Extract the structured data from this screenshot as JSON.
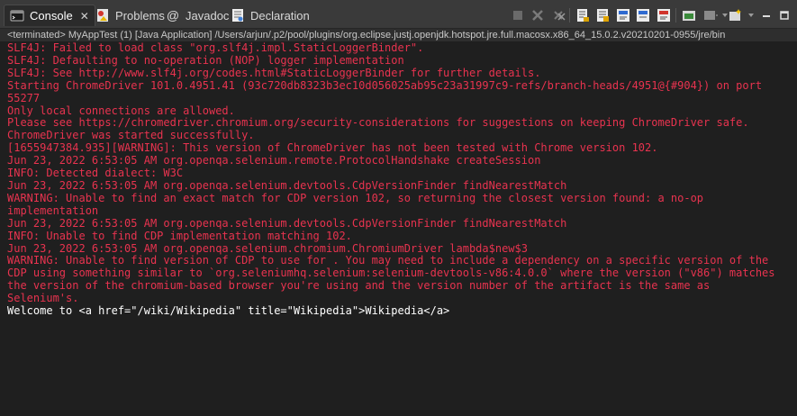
{
  "tabs": [
    {
      "label": "Console",
      "active": true
    },
    {
      "label": "Problems"
    },
    {
      "label": "Javadoc"
    },
    {
      "label": "Declaration"
    }
  ],
  "status_line": "<terminated> MyAppTest (1) [Java Application] /Users/arjun/.p2/pool/plugins/org.eclipse.justj.openjdk.hotspot.jre.full.macosx.x86_64_15.0.2.v20210201-0955/jre/bin",
  "colors": {
    "error_text": "#e8334f",
    "normal_text": "#ffffff",
    "background": "#1f1f1f"
  },
  "console": {
    "lines": [
      {
        "text": "SLF4J: Failed to load class \"org.slf4j.impl.StaticLoggerBinder\".",
        "stream": "err"
      },
      {
        "text": "SLF4J: Defaulting to no-operation (NOP) logger implementation",
        "stream": "err"
      },
      {
        "text": "SLF4J: See http://www.slf4j.org/codes.html#StaticLoggerBinder for further details.",
        "stream": "err"
      },
      {
        "text": "Starting ChromeDriver 101.0.4951.41 (93c720db8323b3ec10d056025ab95c23a31997c9-refs/branch-heads/4951@{#904}) on port",
        "stream": "err"
      },
      {
        "text": "55277",
        "stream": "err"
      },
      {
        "text": "Only local connections are allowed.",
        "stream": "err"
      },
      {
        "text": "Please see https://chromedriver.chromium.org/security-considerations for suggestions on keeping ChromeDriver safe.",
        "stream": "err"
      },
      {
        "text": "ChromeDriver was started successfully.",
        "stream": "err"
      },
      {
        "text": "[1655947384.935][WARNING]: This version of ChromeDriver has not been tested with Chrome version 102.",
        "stream": "err"
      },
      {
        "text": "Jun 23, 2022 6:53:05 AM org.openqa.selenium.remote.ProtocolHandshake createSession",
        "stream": "err"
      },
      {
        "text": "INFO: Detected dialect: W3C",
        "stream": "err"
      },
      {
        "text": "Jun 23, 2022 6:53:05 AM org.openqa.selenium.devtools.CdpVersionFinder findNearestMatch",
        "stream": "err"
      },
      {
        "text": "WARNING: Unable to find an exact match for CDP version 102, so returning the closest version found: a no-op",
        "stream": "err"
      },
      {
        "text": "implementation",
        "stream": "err"
      },
      {
        "text": "Jun 23, 2022 6:53:05 AM org.openqa.selenium.devtools.CdpVersionFinder findNearestMatch",
        "stream": "err"
      },
      {
        "text": "INFO: Unable to find CDP implementation matching 102.",
        "stream": "err"
      },
      {
        "text": "Jun 23, 2022 6:53:05 AM org.openqa.selenium.chromium.ChromiumDriver lambda$new$3",
        "stream": "err"
      },
      {
        "text": "WARNING: Unable to find version of CDP to use for . You may need to include a dependency on a specific version of the",
        "stream": "err"
      },
      {
        "text": "CDP using something similar to `org.seleniumhq.selenium:selenium-devtools-v86:4.0.0` where the version (\"v86\") matches",
        "stream": "err"
      },
      {
        "text": "the version of the chromium-based browser you're using and the version number of the artifact is the same as",
        "stream": "err"
      },
      {
        "text": "Selenium's.",
        "stream": "err"
      },
      {
        "text": "Welcome to <a href=\"/wiki/Wikipedia\" title=\"Wikipedia\">Wikipedia</a>",
        "stream": "out"
      }
    ]
  },
  "toolbar_icons": [
    "terminate-icon",
    "remove-launch-icon",
    "remove-all-terminated-icon",
    "scroll-lock-icon",
    "word-wrap-icon",
    "show-on-stdout-icon",
    "show-on-stderr-icon",
    "pin-console-icon",
    "display-console-icon",
    "open-console-icon",
    "minimize-icon",
    "maximize-icon"
  ]
}
